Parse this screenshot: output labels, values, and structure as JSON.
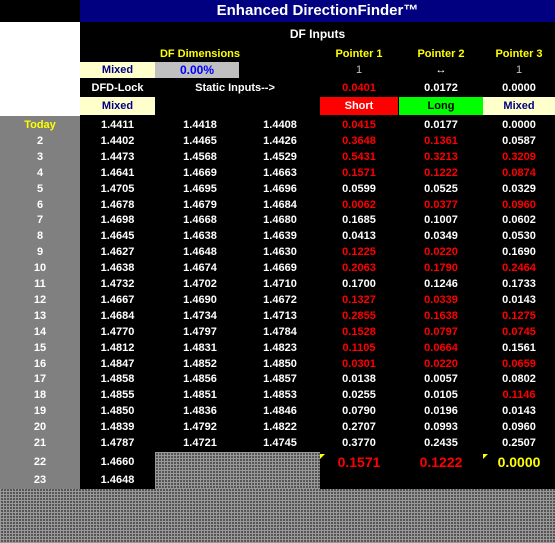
{
  "title": "Enhanced DirectionFinder™",
  "df_inputs_label": "DF Inputs",
  "df_dimensions_label": "DF Dimensions",
  "pointer_headers": [
    "Pointer 1",
    "Pointer 2",
    "Pointer 3"
  ],
  "mixed_top": "Mixed",
  "pct": "0.00%",
  "pointer_inputs": [
    "1",
    "↔",
    "1"
  ],
  "dfd_lock_label": "DFD-Lock",
  "static_inputs_label": "Static Inputs-->",
  "pointer_values": [
    "0.0401",
    "0.0172",
    "0.0000"
  ],
  "mixed_bottom": "Mixed",
  "signals": [
    "Short",
    "Long",
    "Mixed"
  ],
  "rows": [
    {
      "label": "Today",
      "c1": "1.4411",
      "c2": "1.4418",
      "c3": "1.4408",
      "p1": "0.0415",
      "p2": "0.0177",
      "p3": "0.0000",
      "r1": true,
      "r2": false,
      "r3": false
    },
    {
      "label": "2",
      "c1": "1.4402",
      "c2": "1.4465",
      "c3": "1.4426",
      "p1": "0.3648",
      "p2": "0.1361",
      "p3": "0.0587",
      "r1": true,
      "r2": true,
      "r3": false
    },
    {
      "label": "3",
      "c1": "1.4473",
      "c2": "1.4568",
      "c3": "1.4529",
      "p1": "0.5431",
      "p2": "0.3213",
      "p3": "0.3209",
      "r1": true,
      "r2": true,
      "r3": true
    },
    {
      "label": "4",
      "c1": "1.4641",
      "c2": "1.4669",
      "c3": "1.4663",
      "p1": "0.1571",
      "p2": "0.1222",
      "p3": "0.0874",
      "r1": true,
      "r2": true,
      "r3": true
    },
    {
      "label": "5",
      "c1": "1.4705",
      "c2": "1.4695",
      "c3": "1.4696",
      "p1": "0.0599",
      "p2": "0.0525",
      "p3": "0.0329",
      "r1": false,
      "r2": false,
      "r3": false
    },
    {
      "label": "6",
      "c1": "1.4678",
      "c2": "1.4679",
      "c3": "1.4684",
      "p1": "0.0062",
      "p2": "0.0377",
      "p3": "0.0960",
      "r1": true,
      "r2": true,
      "r3": true
    },
    {
      "label": "7",
      "c1": "1.4698",
      "c2": "1.4668",
      "c3": "1.4680",
      "p1": "0.1685",
      "p2": "0.1007",
      "p3": "0.0602",
      "r1": false,
      "r2": false,
      "r3": false
    },
    {
      "label": "8",
      "c1": "1.4645",
      "c2": "1.4638",
      "c3": "1.4639",
      "p1": "0.0413",
      "p2": "0.0349",
      "p3": "0.0530",
      "r1": false,
      "r2": false,
      "r3": false
    },
    {
      "label": "9",
      "c1": "1.4627",
      "c2": "1.4648",
      "c3": "1.4630",
      "p1": "0.1225",
      "p2": "0.0220",
      "p3": "0.1690",
      "r1": true,
      "r2": true,
      "r3": false
    },
    {
      "label": "10",
      "c1": "1.4638",
      "c2": "1.4674",
      "c3": "1.4669",
      "p1": "0.2063",
      "p2": "0.1790",
      "p3": "0.2464",
      "r1": true,
      "r2": true,
      "r3": true
    },
    {
      "label": "11",
      "c1": "1.4732",
      "c2": "1.4702",
      "c3": "1.4710",
      "p1": "0.1700",
      "p2": "0.1246",
      "p3": "0.1733",
      "r1": false,
      "r2": false,
      "r3": false
    },
    {
      "label": "12",
      "c1": "1.4667",
      "c2": "1.4690",
      "c3": "1.4672",
      "p1": "0.1327",
      "p2": "0.0339",
      "p3": "0.0143",
      "r1": true,
      "r2": true,
      "r3": false
    },
    {
      "label": "13",
      "c1": "1.4684",
      "c2": "1.4734",
      "c3": "1.4713",
      "p1": "0.2855",
      "p2": "0.1638",
      "p3": "0.1275",
      "r1": true,
      "r2": true,
      "r3": true
    },
    {
      "label": "14",
      "c1": "1.4770",
      "c2": "1.4797",
      "c3": "1.4784",
      "p1": "0.1528",
      "p2": "0.0797",
      "p3": "0.0745",
      "r1": true,
      "r2": true,
      "r3": true
    },
    {
      "label": "15",
      "c1": "1.4812",
      "c2": "1.4831",
      "c3": "1.4823",
      "p1": "0.1105",
      "p2": "0.0664",
      "p3": "0.1561",
      "r1": true,
      "r2": true,
      "r3": false
    },
    {
      "label": "16",
      "c1": "1.4847",
      "c2": "1.4852",
      "c3": "1.4850",
      "p1": "0.0301",
      "p2": "0.0220",
      "p3": "0.0659",
      "r1": true,
      "r2": true,
      "r3": true
    },
    {
      "label": "17",
      "c1": "1.4858",
      "c2": "1.4856",
      "c3": "1.4857",
      "p1": "0.0138",
      "p2": "0.0057",
      "p3": "0.0802",
      "r1": false,
      "r2": false,
      "r3": false
    },
    {
      "label": "18",
      "c1": "1.4855",
      "c2": "1.4851",
      "c3": "1.4853",
      "p1": "0.0255",
      "p2": "0.0105",
      "p3": "0.1146",
      "r1": false,
      "r2": false,
      "r3": true
    },
    {
      "label": "19",
      "c1": "1.4850",
      "c2": "1.4836",
      "c3": "1.4846",
      "p1": "0.0790",
      "p2": "0.0196",
      "p3": "0.0143",
      "r1": false,
      "r2": false,
      "r3": false
    },
    {
      "label": "20",
      "c1": "1.4839",
      "c2": "1.4792",
      "c3": "1.4822",
      "p1": "0.2707",
      "p2": "0.0993",
      "p3": "0.0960",
      "r1": false,
      "r2": false,
      "r3": false
    },
    {
      "label": "21",
      "c1": "1.4787",
      "c2": "1.4721",
      "c3": "1.4745",
      "p1": "0.3770",
      "p2": "0.2435",
      "p3": "0.2507",
      "r1": false,
      "r2": false,
      "r3": false
    }
  ],
  "row22": {
    "label": "22",
    "c1": "1.4660",
    "p1": "0.1571",
    "p2": "0.1222",
    "p3": "0.0000"
  },
  "row23": {
    "label": "23",
    "c1": "1.4648"
  },
  "colors": {
    "title_bg": "#000080",
    "red": "#ff0000",
    "green": "#00ff00",
    "yellow": "#ffff00",
    "grey": "#808080",
    "cream": "#ffffcc"
  }
}
